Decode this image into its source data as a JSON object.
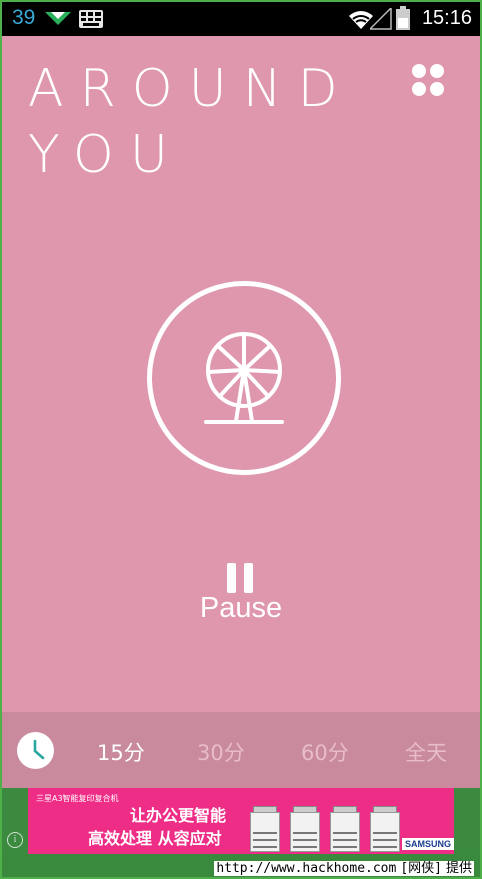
{
  "status_bar": {
    "notification_count": "39",
    "time": "15:16"
  },
  "header": {
    "title_line1": "AROUND",
    "title_line2": "YOU"
  },
  "player": {
    "sound_icon": "ferris-wheel-icon",
    "state_label": "Pause"
  },
  "timer": {
    "options": [
      "15分",
      "30分",
      "60分",
      "全天"
    ],
    "selected": "15分"
  },
  "ad": {
    "small_text": "三星A3智能复印复合机",
    "line1": "让办公更智能",
    "line2": "高效处理 从容应对",
    "brand": "SAMSUNG"
  },
  "watermark": {
    "prefix": "http://www.hackhome.com",
    "site": "[网侠]",
    "suffix": "提供"
  },
  "colors": {
    "main_bg": "#df97ad",
    "timer_bg": "#c98a9d",
    "clock_accent": "#2aa7a0",
    "ad_bg": "#ee2d87"
  }
}
